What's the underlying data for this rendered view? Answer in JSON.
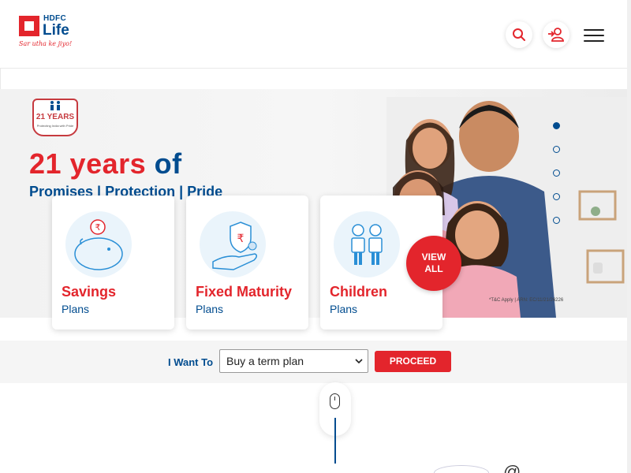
{
  "brand": {
    "name_top": "HDFC",
    "name_main": "Life",
    "tagline": "Sar utha ke jiyo!",
    "red": "#e3252c",
    "blue": "#004c8f"
  },
  "header": {
    "search_icon": "search-icon",
    "login_icon": "user-login-icon",
    "menu_icon": "hamburger-menu-icon"
  },
  "hero": {
    "badge_title": "21 YEARS",
    "badge_sub": "Protecting India with Pride",
    "title_main": "21 years",
    "title_of": "of",
    "subtitle": "Promises | Protection | Pride",
    "tc": "*T&C Apply | ARN: EC/11/21/26226",
    "slides": 5,
    "active_slide": 1
  },
  "cards": [
    {
      "title": "Savings",
      "sub": "Plans",
      "icon": "piggy-bank-icon"
    },
    {
      "title": "Fixed Maturity",
      "sub": "Plans",
      "icon": "rupee-shield-hand-icon"
    },
    {
      "title": "Children",
      "sub": "Plans",
      "icon": "children-icon"
    }
  ],
  "view_all": {
    "line1": "VIEW",
    "line2": "ALL"
  },
  "want": {
    "label": "I Want To",
    "selected": "Buy a term plan",
    "button": "PROCEED"
  }
}
